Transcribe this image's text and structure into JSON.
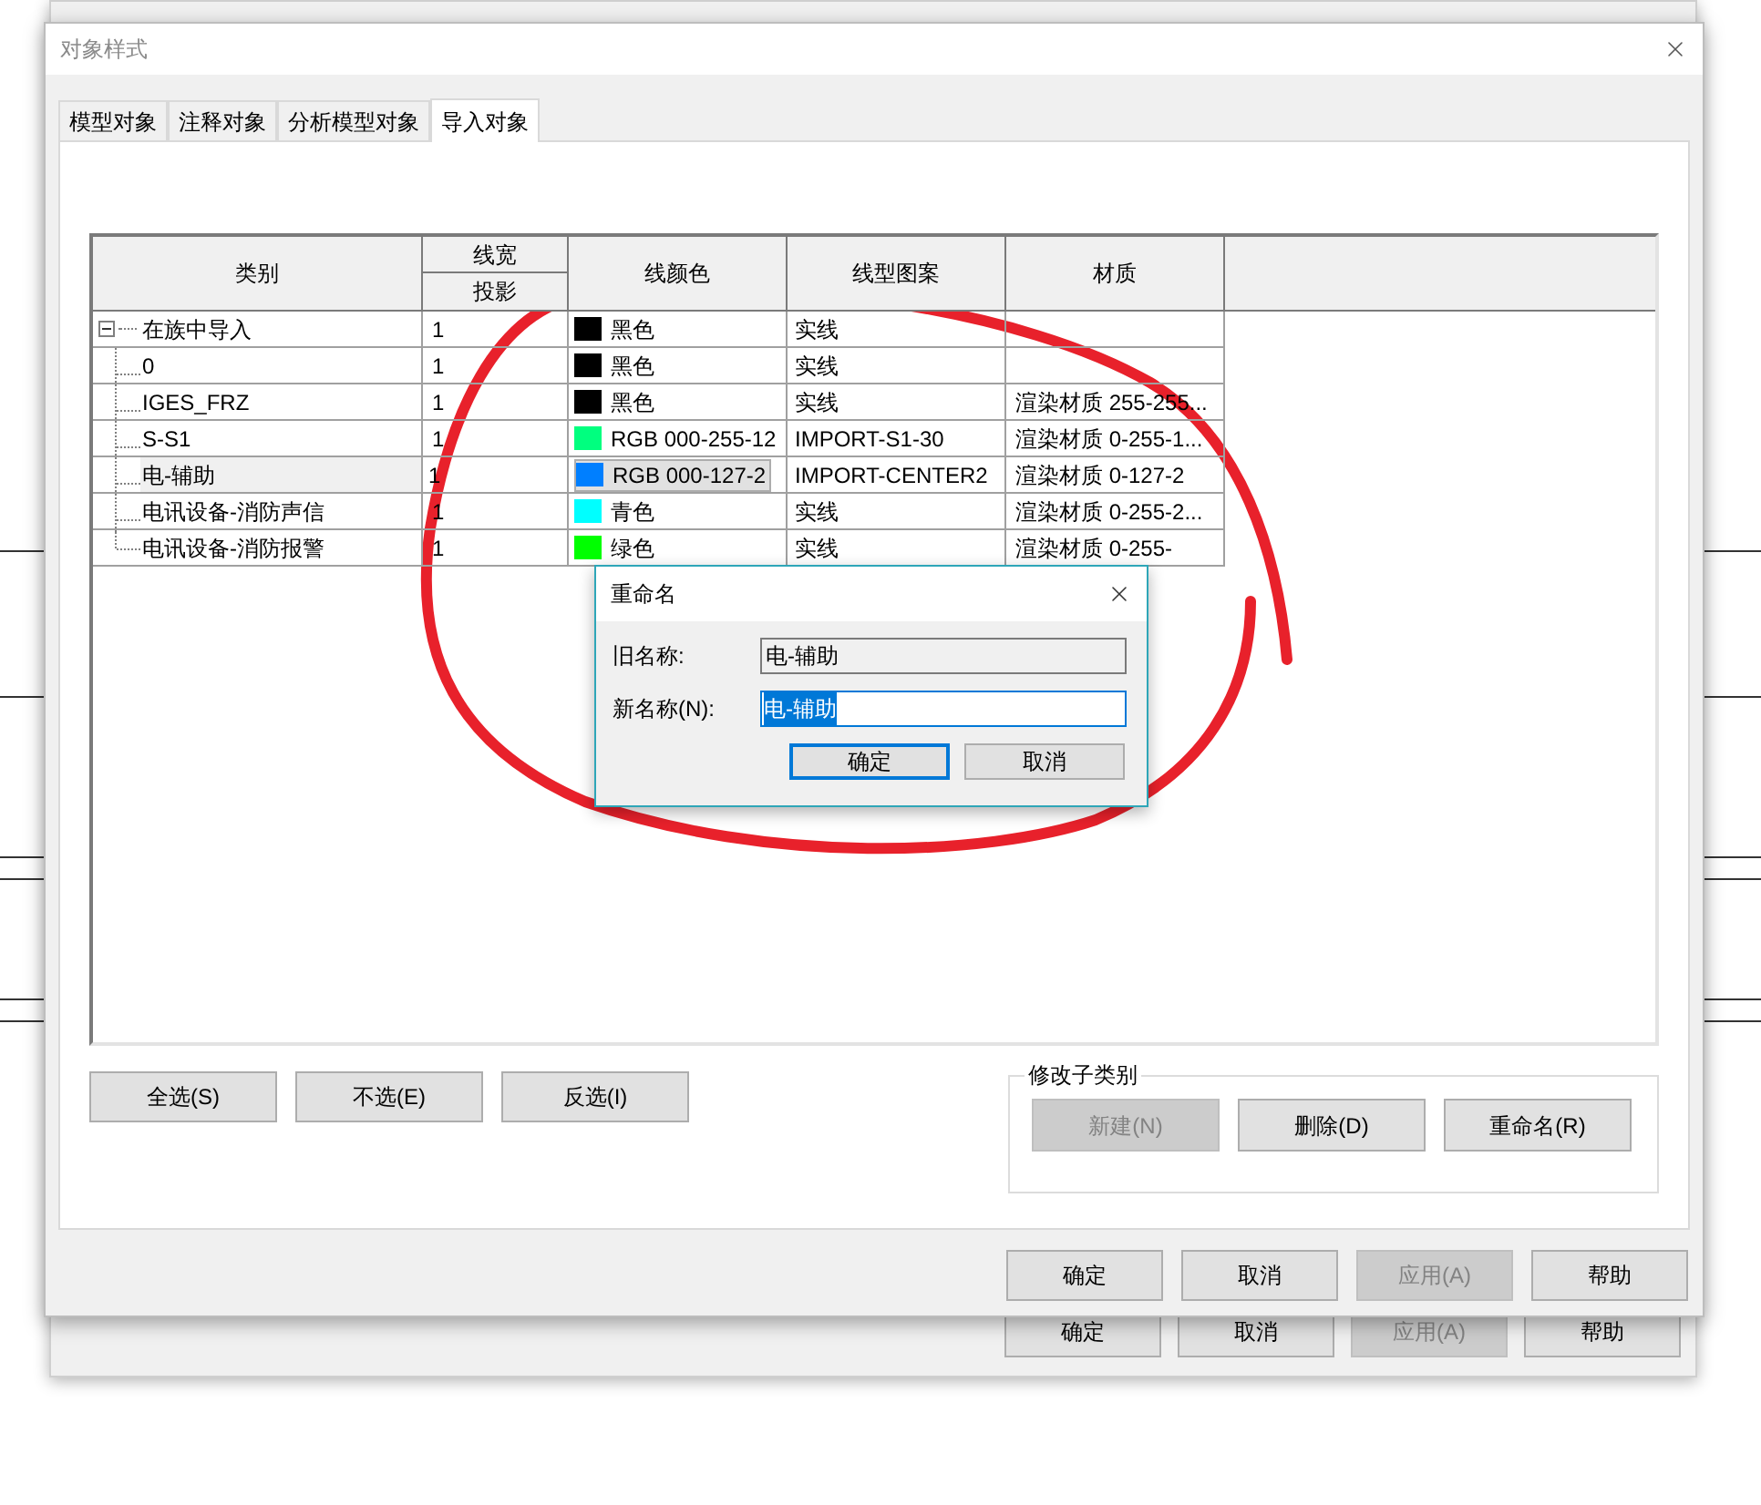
{
  "back_window": {
    "buttons": [
      {
        "label": "确定",
        "disabled": false
      },
      {
        "label": "取消",
        "disabled": false
      },
      {
        "label": "应用(A)",
        "disabled": true
      },
      {
        "label": "帮助",
        "disabled": false
      }
    ]
  },
  "window": {
    "title": "对象样式"
  },
  "tabs": [
    {
      "label": "模型对象",
      "selected": false
    },
    {
      "label": "注释对象",
      "selected": false
    },
    {
      "label": "分析模型对象",
      "selected": false
    },
    {
      "label": "导入对象",
      "selected": true
    }
  ],
  "table": {
    "columns": [
      "类别",
      "线宽",
      "投影",
      "线颜色",
      "线型图案",
      "材质"
    ],
    "rows": [
      {
        "name": "在族中导入",
        "line_weight": "1",
        "color_label": "黑色",
        "color": "#000000",
        "pattern": "实线",
        "selected": false,
        "expanded": true,
        "children": [
          {
            "name": "0",
            "line_weight": "1",
            "color_label": "黑色",
            "color": "#000000",
            "pattern": "实线",
            "selected": false
          },
          {
            "name": "IGES_FRZ",
            "line_weight": "1",
            "color_label": "黑色",
            "color": "#000000",
            "pattern": "实线",
            "material": "渲染材质 255-255...",
            "selected": false
          },
          {
            "name": "S-S1",
            "line_weight": "1",
            "color_label": "RGB 000-255-12",
            "color": "#00ff7f",
            "pattern": "IMPORT-S1-30",
            "material": "渲染材质 0-255-1...",
            "selected": false
          },
          {
            "name": "电-辅助",
            "line_weight": "1",
            "color_label": "RGB 000-127-2",
            "color": "#007fff",
            "pattern": "IMPORT-CENTER2",
            "material": "渲染材质 0-127-2",
            "selected": true
          },
          {
            "name": "电讯设备-消防声信",
            "line_weight": "1",
            "color_label": "青色",
            "color": "#00ffff",
            "pattern": "实线",
            "material": "渲染材质 0-255-2...",
            "selected": false
          },
          {
            "name": "电讯设备-消防报警",
            "line_weight": "1",
            "color_label": "绿色",
            "color": "#00ff00",
            "pattern": "实线",
            "material": "渲染材质 0-255-",
            "selected": false
          }
        ]
      }
    ]
  },
  "select_buttons": [
    "全选(S)",
    "不选(E)",
    "反选(I)"
  ],
  "subcategory_group": {
    "title": "修改子类别",
    "buttons": [
      {
        "label": "新建(N)",
        "disabled": true
      },
      {
        "label": "删除(D)",
        "disabled": false
      },
      {
        "label": "重命名(R)",
        "disabled": false
      }
    ]
  },
  "dialog_buttons": [
    {
      "label": "确定",
      "disabled": false
    },
    {
      "label": "取消",
      "disabled": false
    },
    {
      "label": "应用(A)",
      "disabled": true
    },
    {
      "label": "帮助",
      "disabled": false
    }
  ],
  "rename_dialog": {
    "title": "重命名",
    "old_name_label": "旧名称:",
    "old_name": "电-辅助",
    "new_name_label": "新名称(N):",
    "new_name": "电-辅助",
    "ok": "确定",
    "cancel": "取消"
  }
}
